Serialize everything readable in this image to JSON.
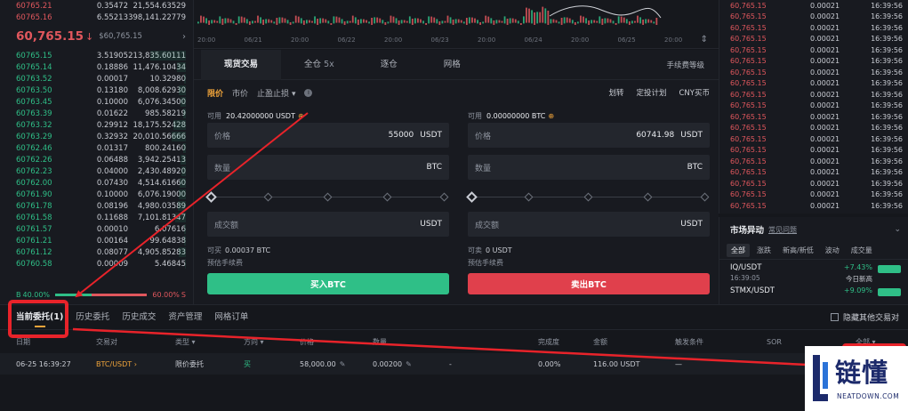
{
  "orderbook": {
    "asks": [
      {
        "price": "60765.21",
        "qty": "0.35472",
        "total": "21,554.63529"
      },
      {
        "price": "60765.16",
        "qty": "6.55213",
        "total": "398,141.22779"
      }
    ],
    "current_price": "60,765.15",
    "current_arrow": "↓",
    "current_sub": "$60,765.15",
    "bids": [
      {
        "price": "60765.15",
        "qty": "3.51905",
        "total": "213,835.60111"
      },
      {
        "price": "60765.14",
        "qty": "0.18886",
        "total": "11,476.10434"
      },
      {
        "price": "60763.52",
        "qty": "0.00017",
        "total": "10.32980"
      },
      {
        "price": "60763.50",
        "qty": "0.13180",
        "total": "8,008.62930"
      },
      {
        "price": "60763.45",
        "qty": "0.10000",
        "total": "6,076.34500"
      },
      {
        "price": "60763.39",
        "qty": "0.01622",
        "total": "985.58219"
      },
      {
        "price": "60763.32",
        "qty": "0.29912",
        "total": "18,175.52428"
      },
      {
        "price": "60763.29",
        "qty": "0.32932",
        "total": "20,010.56666"
      },
      {
        "price": "60762.46",
        "qty": "0.01317",
        "total": "800.24160"
      },
      {
        "price": "60762.26",
        "qty": "0.06488",
        "total": "3,942.25413"
      },
      {
        "price": "60762.23",
        "qty": "0.04000",
        "total": "2,430.48920"
      },
      {
        "price": "60762.00",
        "qty": "0.07430",
        "total": "4,514.61660"
      },
      {
        "price": "60761.90",
        "qty": "0.10000",
        "total": "6,076.19000"
      },
      {
        "price": "60761.78",
        "qty": "0.08196",
        "total": "4,980.03589"
      },
      {
        "price": "60761.58",
        "qty": "0.11688",
        "total": "7,101.81347"
      },
      {
        "price": "60761.57",
        "qty": "0.00010",
        "total": "6.07616"
      },
      {
        "price": "60761.21",
        "qty": "0.00164",
        "total": "99.64838"
      },
      {
        "price": "60761.12",
        "qty": "0.08077",
        "total": "4,905.85283"
      },
      {
        "price": "60760.58",
        "qty": "0.00009",
        "total": "5.46845"
      }
    ],
    "buy_label": "B",
    "buy_pct": "40.00%",
    "sell_label": "S",
    "sell_pct": "60.00%",
    "buy_ratio": 0.4
  },
  "chart": {
    "x_labels": [
      "20:00",
      "06/21",
      "20:00",
      "06/22",
      "20:00",
      "06/23",
      "20:00",
      "06/24",
      "20:00",
      "06/25",
      "20:00"
    ]
  },
  "trade": {
    "tabs": [
      {
        "label": "现货交易",
        "extra": ""
      },
      {
        "label": "全仓",
        "extra": "5x"
      },
      {
        "label": "逐仓",
        "extra": ""
      },
      {
        "label": "网格",
        "extra": ""
      }
    ],
    "fee_level": "手续费等级",
    "order_types": [
      "限价",
      "市价",
      "盈止损"
    ],
    "stop_prefix": "止",
    "links": [
      "划转",
      "定投计划",
      "CNY买币"
    ],
    "buy": {
      "avail_label": "可用",
      "avail_value": "20.42000000 USDT",
      "price_label": "价格",
      "price_value": "55000",
      "price_unit": "USDT",
      "qty_label": "数量",
      "qty_unit": "BTC",
      "total_label": "成交额",
      "total_unit": "USDT",
      "can_label": "可买",
      "can_value": "0.00037 BTC",
      "fee_label": "预估手续费",
      "button": "买入BTC"
    },
    "sell": {
      "avail_label": "可用",
      "avail_value": "0.00000000 BTC",
      "price_label": "价格",
      "price_value": "60741.98",
      "price_unit": "USDT",
      "qty_label": "数量",
      "qty_unit": "BTC",
      "total_label": "成交额",
      "total_unit": "USDT",
      "can_label": "可卖",
      "can_value": "0 USDT",
      "fee_label": "预估手续费",
      "button": "卖出BTC"
    }
  },
  "trades": {
    "rows": [
      {
        "price": "60,765.15",
        "qty": "0.00021",
        "time": "16:39:56"
      },
      {
        "price": "60,765.15",
        "qty": "0.00021",
        "time": "16:39:56"
      },
      {
        "price": "60,765.15",
        "qty": "0.00021",
        "time": "16:39:56"
      },
      {
        "price": "60,765.15",
        "qty": "0.00021",
        "time": "16:39:56"
      },
      {
        "price": "60,765.15",
        "qty": "0.00021",
        "time": "16:39:56"
      },
      {
        "price": "60,765.15",
        "qty": "0.00021",
        "time": "16:39:56"
      },
      {
        "price": "60,765.15",
        "qty": "0.00021",
        "time": "16:39:56"
      },
      {
        "price": "60,765.15",
        "qty": "0.00021",
        "time": "16:39:56"
      },
      {
        "price": "60,765.15",
        "qty": "0.00021",
        "time": "16:39:56"
      },
      {
        "price": "60,765.15",
        "qty": "0.00021",
        "time": "16:39:56"
      },
      {
        "price": "60,765.15",
        "qty": "0.00021",
        "time": "16:39:56"
      },
      {
        "price": "60,765.15",
        "qty": "0.00021",
        "time": "16:39:56"
      },
      {
        "price": "60,765.15",
        "qty": "0.00021",
        "time": "16:39:56"
      },
      {
        "price": "60,765.15",
        "qty": "0.00021",
        "time": "16:39:56"
      },
      {
        "price": "60,765.15",
        "qty": "0.00021",
        "time": "16:39:56"
      },
      {
        "price": "60,765.15",
        "qty": "0.00021",
        "time": "16:39:56"
      },
      {
        "price": "60,765.15",
        "qty": "0.00021",
        "time": "16:39:56"
      },
      {
        "price": "60,765.15",
        "qty": "0.00021",
        "time": "16:39:56"
      },
      {
        "price": "60,765.15",
        "qty": "0.00021",
        "time": "16:39:56"
      }
    ]
  },
  "movers": {
    "title": "市场异动",
    "faq": "常见问题",
    "tabs": [
      "全部",
      "涨跌",
      "新高/新低",
      "波动",
      "成交量"
    ],
    "items": [
      {
        "symbol": "IQ/USDT",
        "time": "16:39:05",
        "change": "+7.43%",
        "tag": "今日新高"
      },
      {
        "symbol": "STMX/USDT",
        "time": "",
        "change": "+9.09%",
        "tag": ""
      }
    ]
  },
  "orders": {
    "tabs": [
      "当前委托(1)",
      "历史委托",
      "历史成交",
      "资产管理",
      "网格订单"
    ],
    "hide_other": "隐藏其他交易对",
    "headers": [
      "日期",
      "交易对",
      "类型",
      "方向",
      "价格",
      "数量",
      "完成度",
      "金额",
      "触发条件",
      "SOR",
      "全部"
    ],
    "rows": [
      {
        "date": "06-25 16:39:27",
        "pair": "BTC/USDT",
        "type": "限价委托",
        "side": "买",
        "price": "58,000.00",
        "qty": "0.00200",
        "filled": "-",
        "progress": "0.00%",
        "amount": "116.00 USDT",
        "trigger": "—"
      }
    ]
  },
  "watermark": {
    "name": "链懂",
    "site": "NEATDOWN.COM"
  },
  "colors": {
    "up": "#2fbf87",
    "down": "#e0575d",
    "accent": "#f0a43a",
    "annotation": "#e8232a"
  }
}
